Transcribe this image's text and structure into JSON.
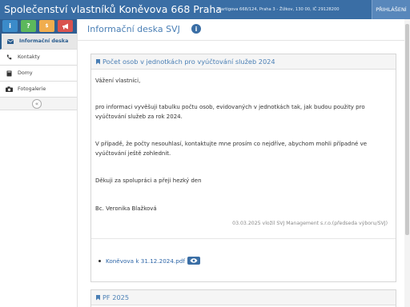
{
  "header": {
    "title": "Společenství vlastníků Koněvova 668 Praha",
    "address": "Hartigova 668/124, Praha 3 - Žižkov, 130 00, IČ 29128200",
    "login_label": "PŘIHLÁŠENÍ"
  },
  "sidebar": {
    "quick_icons": [
      {
        "icon": "info-icon",
        "glyph": "i",
        "color": "#3b8bc9"
      },
      {
        "icon": "question-icon",
        "glyph": "?",
        "color": "#5cb85c"
      },
      {
        "icon": "dollar-icon",
        "glyph": "$",
        "color": "#f0ad4e"
      },
      {
        "icon": "megaphone-icon",
        "glyph": "",
        "color": "#d9534f"
      }
    ],
    "items": [
      {
        "label": "Informační deska",
        "icon": "envelope-icon",
        "active": true
      },
      {
        "label": "Kontakty",
        "icon": "phone-icon",
        "active": false
      },
      {
        "label": "Domy",
        "icon": "book-icon",
        "active": false
      },
      {
        "label": "Fotogalerie",
        "icon": "camera-icon",
        "active": false
      }
    ],
    "collapse_glyph": "«"
  },
  "main": {
    "page_title": "Informační deska SVJ",
    "info_glyph": "i",
    "notices": [
      {
        "title": "Počet osob v jednotkách pro vyúčtování služeb 2024",
        "greeting": "Vážení vlastníci,",
        "para1_line1": "pro informaci vyvěšuji tabulku počtu osob, evidovaných v jednotkách tak, jak budou použity pro",
        "para1_line2": "vyúčtování služeb za rok 2024.",
        "para2_line1": "V případě, že počty nesouhlasí, kontaktujte mne prosím co nejdříve, abychom mohli případné ve",
        "para2_line2": "vyúčtování ještě zohlednit.",
        "thanks": "Děkuji za spolupráci a přeji hezký den",
        "signature": "Bc. Veronika Blažková",
        "posted": "03.03.2025 vložil SVJ Management s.r.o.(předseda výboru/SVJ)",
        "attachments": [
          {
            "name": "Koněvova k 31.12.2024.pdf"
          }
        ]
      },
      {
        "title": "PF 2025"
      }
    ]
  },
  "colors": {
    "header_bg": "#3a6ea5",
    "accent": "#4a7fb5",
    "link": "#2f67a8"
  }
}
